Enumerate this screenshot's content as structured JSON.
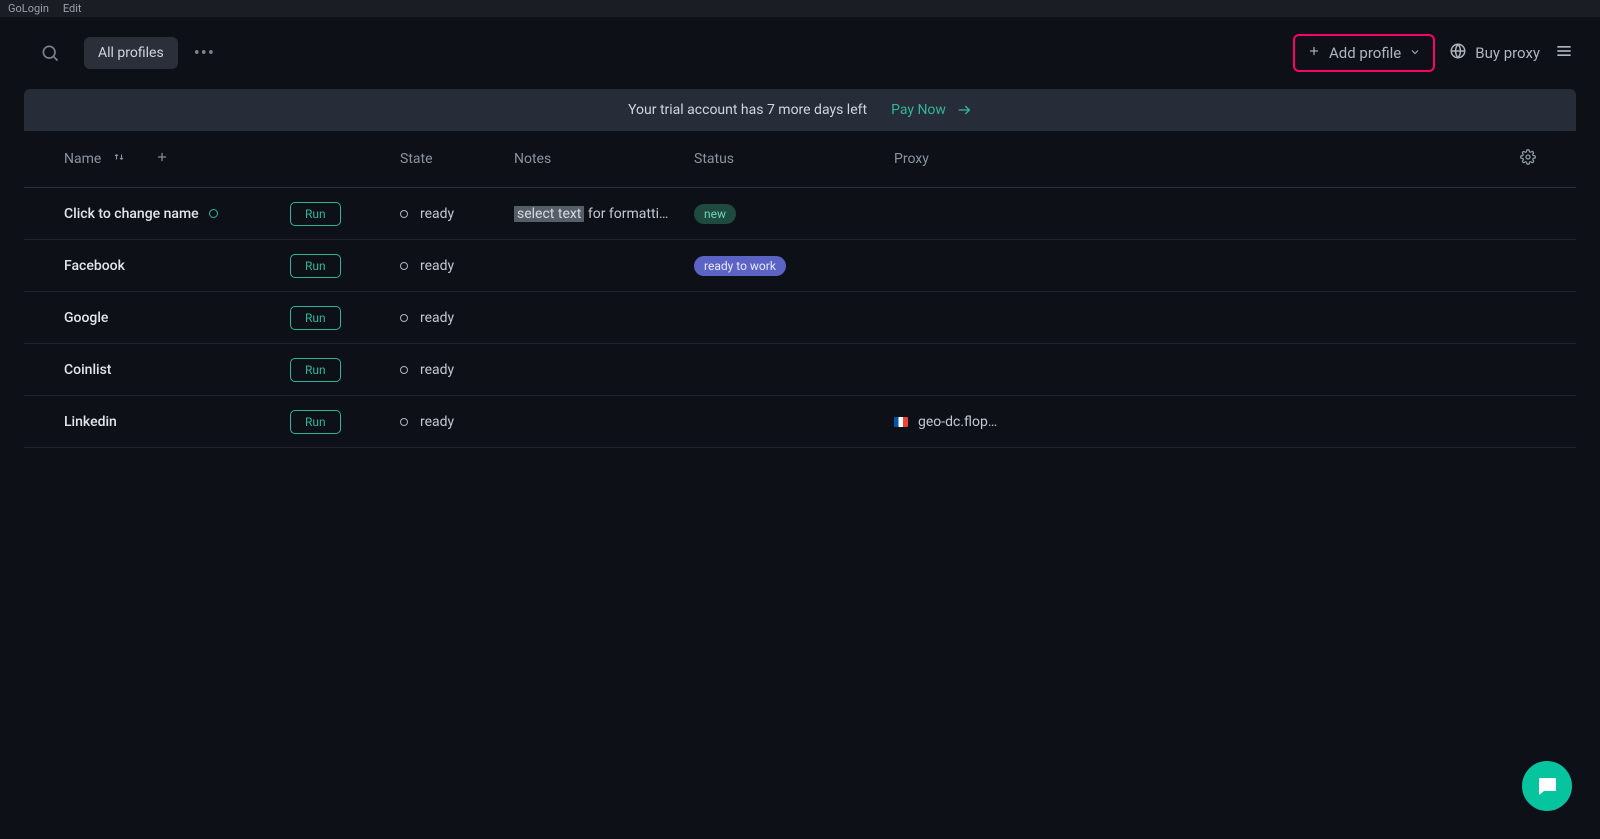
{
  "titlebar": {
    "app_name": "GoLogin",
    "edit_label": "Edit"
  },
  "header": {
    "all_profiles_label": "All profiles",
    "add_profile_label": "Add profile",
    "buy_proxy_label": "Buy proxy"
  },
  "trial": {
    "message": "Your trial account has 7 more days left",
    "pay_now_label": "Pay Now"
  },
  "columns": {
    "name": "Name",
    "state": "State",
    "notes": "Notes",
    "status": "Status",
    "proxy": "Proxy"
  },
  "run_label": "Run",
  "rows": [
    {
      "name": "Click to change name",
      "show_dot": true,
      "state": "ready",
      "notes_highlight": "select text",
      "notes_rest": " for formatti…",
      "status_label": "new",
      "status_class": "green",
      "proxy_flag": "",
      "proxy_text": ""
    },
    {
      "name": "Facebook",
      "show_dot": false,
      "state": "ready",
      "notes_highlight": "",
      "notes_rest": "",
      "status_label": "ready to work",
      "status_class": "purple",
      "proxy_flag": "",
      "proxy_text": ""
    },
    {
      "name": "Google",
      "show_dot": false,
      "state": "ready",
      "notes_highlight": "",
      "notes_rest": "",
      "status_label": "",
      "status_class": "",
      "proxy_flag": "",
      "proxy_text": ""
    },
    {
      "name": "Coinlist",
      "show_dot": false,
      "state": "ready",
      "notes_highlight": "",
      "notes_rest": "",
      "status_label": "",
      "status_class": "",
      "proxy_flag": "",
      "proxy_text": ""
    },
    {
      "name": "Linkedin",
      "show_dot": false,
      "state": "ready",
      "notes_highlight": "",
      "notes_rest": "",
      "status_label": "",
      "status_class": "",
      "proxy_flag": "fr",
      "proxy_text": "geo-dc.flop…"
    }
  ]
}
